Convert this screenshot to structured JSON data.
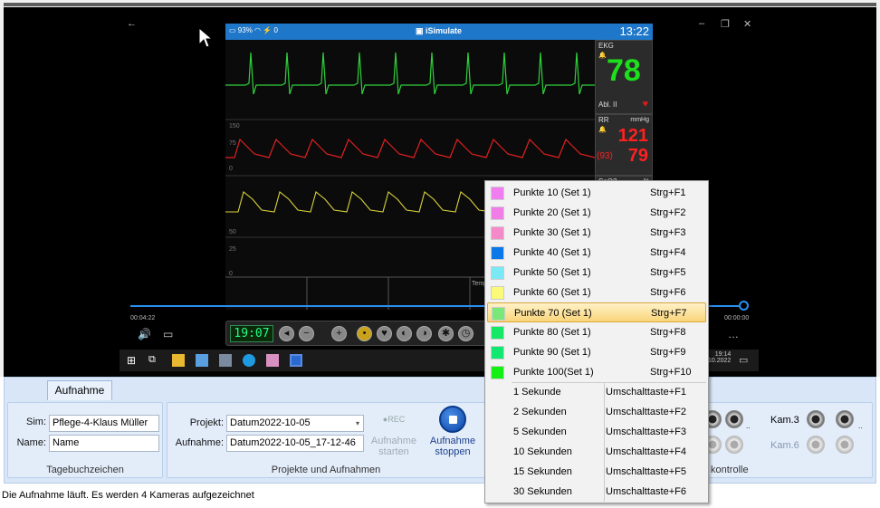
{
  "monitor": {
    "battery": "93%",
    "header_count": "0",
    "app_name": "iSimulate",
    "clock": "13:22",
    "ekg": {
      "label": "EKG",
      "value": "78",
      "lead": "Abl. II"
    },
    "rr": {
      "label": "RR",
      "unit": "mmHg",
      "sys": "121",
      "mean": "(93)",
      "dia": "79"
    },
    "spo2": {
      "label": "SpO2",
      "unit": "%"
    },
    "scales": [
      "150",
      "75",
      "0",
      "50",
      "25",
      "0"
    ],
    "temp_label": "Temp",
    "lcd_time": "19:07"
  },
  "player": {
    "elapsed": "00:04:22",
    "total": "00:00:00"
  },
  "taskbar": {
    "time": "19:14",
    "date": "10.2022"
  },
  "tab": {
    "label": "Aufnahme"
  },
  "tagebuch": {
    "sim_label": "Sim:",
    "sim_value": "Pflege-4-Klaus Müller",
    "name_label": "Name:",
    "name_value": "Name",
    "caption": "Tagebuchzeichen"
  },
  "projekte": {
    "projekt_label": "Projekt:",
    "projekt_value": "Datum2022-10-05",
    "aufnahme_label": "Aufnahme:",
    "aufnahme_value": "Datum2022-10-05_17-12-46",
    "rec_icon": "●REC",
    "start_label_1": "Aufnahme",
    "start_label_2": "starten",
    "stop_label_1": "Aufnahme",
    "stop_label_2": "stoppen",
    "caption": "Projekte und Aufnahmen"
  },
  "kamera": {
    "kam3": "Kam.3",
    "kam6": "Kam.6",
    "caption_tail": "kontrolle"
  },
  "status": "Die Aufnahme läuft. Es werden 4 Kameras  aufgezeichnet",
  "menu": {
    "items": [
      {
        "name": "Punkte 10 (Set 1)",
        "shortcut": "Strg+F1",
        "color": "#f07ef0"
      },
      {
        "name": "Punkte 20 (Set 1)",
        "shortcut": "Strg+F2",
        "color": "#f07ee6"
      },
      {
        "name": "Punkte 30 (Set 1)",
        "shortcut": "Strg+F3",
        "color": "#f58ac8"
      },
      {
        "name": "Punkte 40 (Set 1)",
        "shortcut": "Strg+F4",
        "color": "#0a78e8"
      },
      {
        "name": "Punkte 50 (Set 1)",
        "shortcut": "Strg+F5",
        "color": "#7ae8f5"
      },
      {
        "name": "Punkte 60 (Set 1)",
        "shortcut": "Strg+F6",
        "color": "#fafa78"
      },
      {
        "name": "Punkte 70 (Set 1)",
        "shortcut": "Strg+F7",
        "color": "#78e878"
      },
      {
        "name": "Punkte 80 (Set 1)",
        "shortcut": "Strg+F8",
        "color": "#14e864"
      },
      {
        "name": "Punkte 90 (Set 1)",
        "shortcut": "Strg+F9",
        "color": "#10e870"
      },
      {
        "name": "Punkte 100(Set 1)",
        "shortcut": "Strg+F10",
        "color": "#14f014"
      },
      {
        "name": "1 Sekunde",
        "shortcut": "Umschalttaste+F1",
        "color": ""
      },
      {
        "name": "2 Sekunden",
        "shortcut": "Umschalttaste+F2",
        "color": ""
      },
      {
        "name": "5 Sekunden",
        "shortcut": "Umschalttaste+F3",
        "color": ""
      },
      {
        "name": "10 Sekunden",
        "shortcut": "Umschalttaste+F4",
        "color": ""
      },
      {
        "name": "15 Sekunden",
        "shortcut": "Umschalttaste+F5",
        "color": ""
      },
      {
        "name": "30 Sekunden",
        "shortcut": "Umschalttaste+F6",
        "color": ""
      }
    ],
    "highlighted_index": 6
  }
}
